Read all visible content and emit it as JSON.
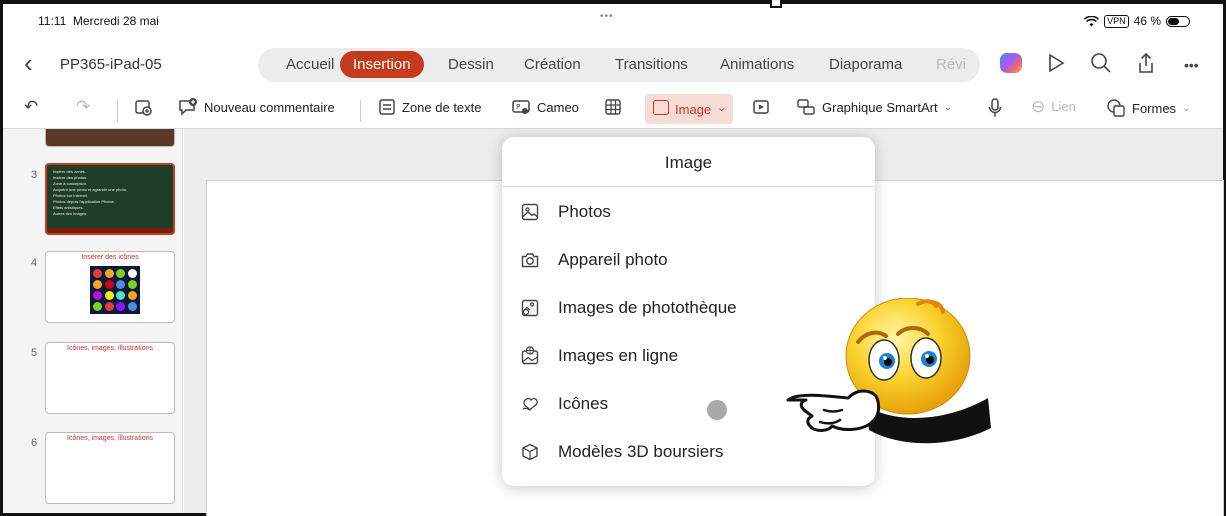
{
  "status_bar": {
    "time": "11:11",
    "date": "Mercredi 28 mai",
    "dots": "•••",
    "vpn": "VPN",
    "battery": "46 %"
  },
  "header": {
    "doc_name": "PP365-iPad-05",
    "tabs": [
      {
        "label": "Accueil"
      },
      {
        "label": "Insertion",
        "active": true
      },
      {
        "label": "Dessin"
      },
      {
        "label": "Création"
      },
      {
        "label": "Transitions"
      },
      {
        "label": "Animations"
      },
      {
        "label": "Diaporama"
      },
      {
        "label": "Révi"
      }
    ]
  },
  "ribbon": {
    "comment": "Nouveau commentaire",
    "textbox": "Zone de texte",
    "cameo": "Cameo",
    "image": "Image",
    "smartart": "Graphique SmartArt",
    "link": "Lien",
    "shapes": "Formes"
  },
  "slides": [
    {
      "number": "3",
      "lines": [
        "Insérer des zones.",
        "Insérer des photos.",
        "Zone à conception.",
        "Acquérir une photo et agrandir une photo.",
        "Photos sur Internet.",
        "Photos depuis l'application Photos.",
        "Effets artistiques.",
        "Autres des images."
      ]
    },
    {
      "number": "4",
      "title": "Insérer des icônes"
    },
    {
      "number": "5",
      "title": "Icônes, images, illustrations"
    },
    {
      "number": "6",
      "title": "Icônes, images, illustrations"
    }
  ],
  "image_menu": {
    "title": "Image",
    "items": [
      {
        "label": "Photos",
        "icon": "photo-icon"
      },
      {
        "label": "Appareil photo",
        "icon": "camera-icon"
      },
      {
        "label": "Images de photothèque",
        "icon": "stock-images-icon"
      },
      {
        "label": "Images en ligne",
        "icon": "online-images-icon"
      },
      {
        "label": "Icônes",
        "icon": "icons-icon"
      },
      {
        "label": "Modèles 3D boursiers",
        "icon": "3d-model-icon"
      }
    ]
  },
  "colors": {
    "accent": "#c43c1e",
    "tab_strip": "#ececec",
    "canvas": "#ececec"
  }
}
